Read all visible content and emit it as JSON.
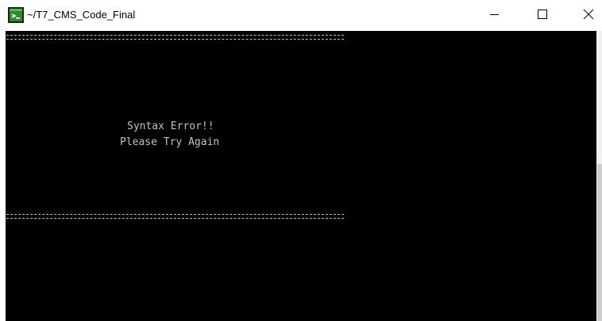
{
  "window": {
    "title": "~/T7_CMS_Code_Final",
    "icon": "terminal-app-icon",
    "controls": {
      "minimize_icon": "minimize-icon",
      "maximize_icon": "maximize-icon",
      "close_icon": "close-icon"
    }
  },
  "terminal": {
    "separator_top": "=============================================================",
    "messages": [
      "Syntax Error!!",
      "Please Try Again"
    ],
    "separator_bottom": "=============================================================",
    "colors": {
      "background": "#000000",
      "foreground": "#c0c0c0"
    }
  }
}
